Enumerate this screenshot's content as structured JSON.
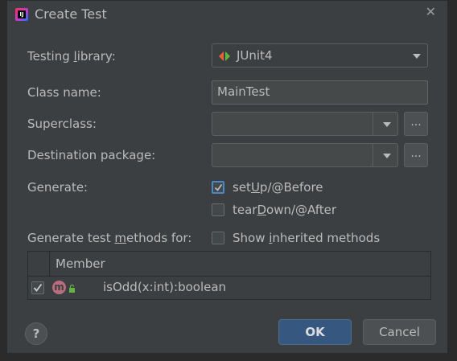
{
  "window": {
    "title": "Create Test",
    "close_glyph": "✕",
    "app_icon": "intellij-icon"
  },
  "form": {
    "testing_library_label": "Testing library:",
    "testing_library_value": "JUnit4",
    "class_name_label": "Class name:",
    "class_name_value": "MainTest",
    "superclass_label": "Superclass:",
    "superclass_value": "",
    "destination_package_label": "Destination package:",
    "destination_package_value": "",
    "browse_label": "...",
    "generate_label": "Generate:",
    "setup_label": "setUp/@Before",
    "setup_checked": true,
    "teardown_label": "tearDown/@After",
    "teardown_checked": false,
    "generate_methods_label": "Generate test methods for:",
    "show_inherited_label": "Show inherited methods",
    "show_inherited_checked": false
  },
  "table": {
    "header": "Member",
    "rows": [
      {
        "checked": true,
        "icon": "method-icon",
        "icon_letter": "m",
        "visibility": "public-lock-icon",
        "member": "isOdd(x:int):boolean"
      }
    ]
  },
  "buttons": {
    "help": "?",
    "ok": "OK",
    "cancel": "Cancel"
  },
  "colors": {
    "accent": "#4a88c7",
    "ok_button": "#365880",
    "background": "#3c3f41",
    "method_icon": "#ba6d7f"
  }
}
